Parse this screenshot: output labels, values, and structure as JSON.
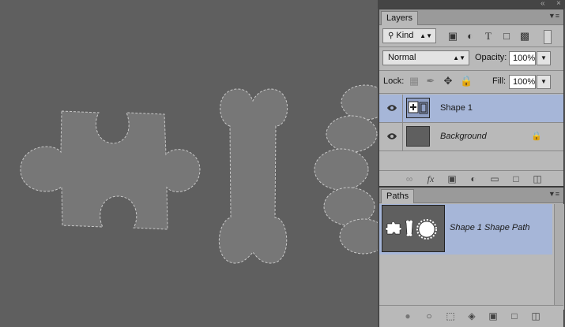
{
  "layers_panel": {
    "tab": "Layers",
    "filter_kind": "Kind",
    "blend_mode": "Normal",
    "opacity_label": "Opacity:",
    "opacity_value": "100%",
    "lock_label": "Lock:",
    "fill_label": "Fill:",
    "fill_value": "100%",
    "layers": [
      {
        "name": "Shape 1",
        "selected": true,
        "visible": true
      },
      {
        "name": "Background",
        "selected": false,
        "visible": true,
        "locked": true
      }
    ],
    "bottom_icons": [
      "link-icon",
      "fx-icon",
      "mask-icon",
      "adjustment-icon",
      "folder-icon",
      "new-layer-icon",
      "trash-icon"
    ]
  },
  "paths_panel": {
    "tab": "Paths",
    "paths": [
      {
        "name": "Shape 1 Shape Path",
        "selected": true
      }
    ],
    "bottom_icons": [
      "fill-path-icon",
      "stroke-path-icon",
      "selection-icon",
      "work-path-icon",
      "mask-icon",
      "new-path-icon",
      "trash-icon"
    ]
  },
  "colors": {
    "canvas": "#5f5f5f",
    "selection": "#a6b6d8",
    "shape_fill": "#777777"
  }
}
